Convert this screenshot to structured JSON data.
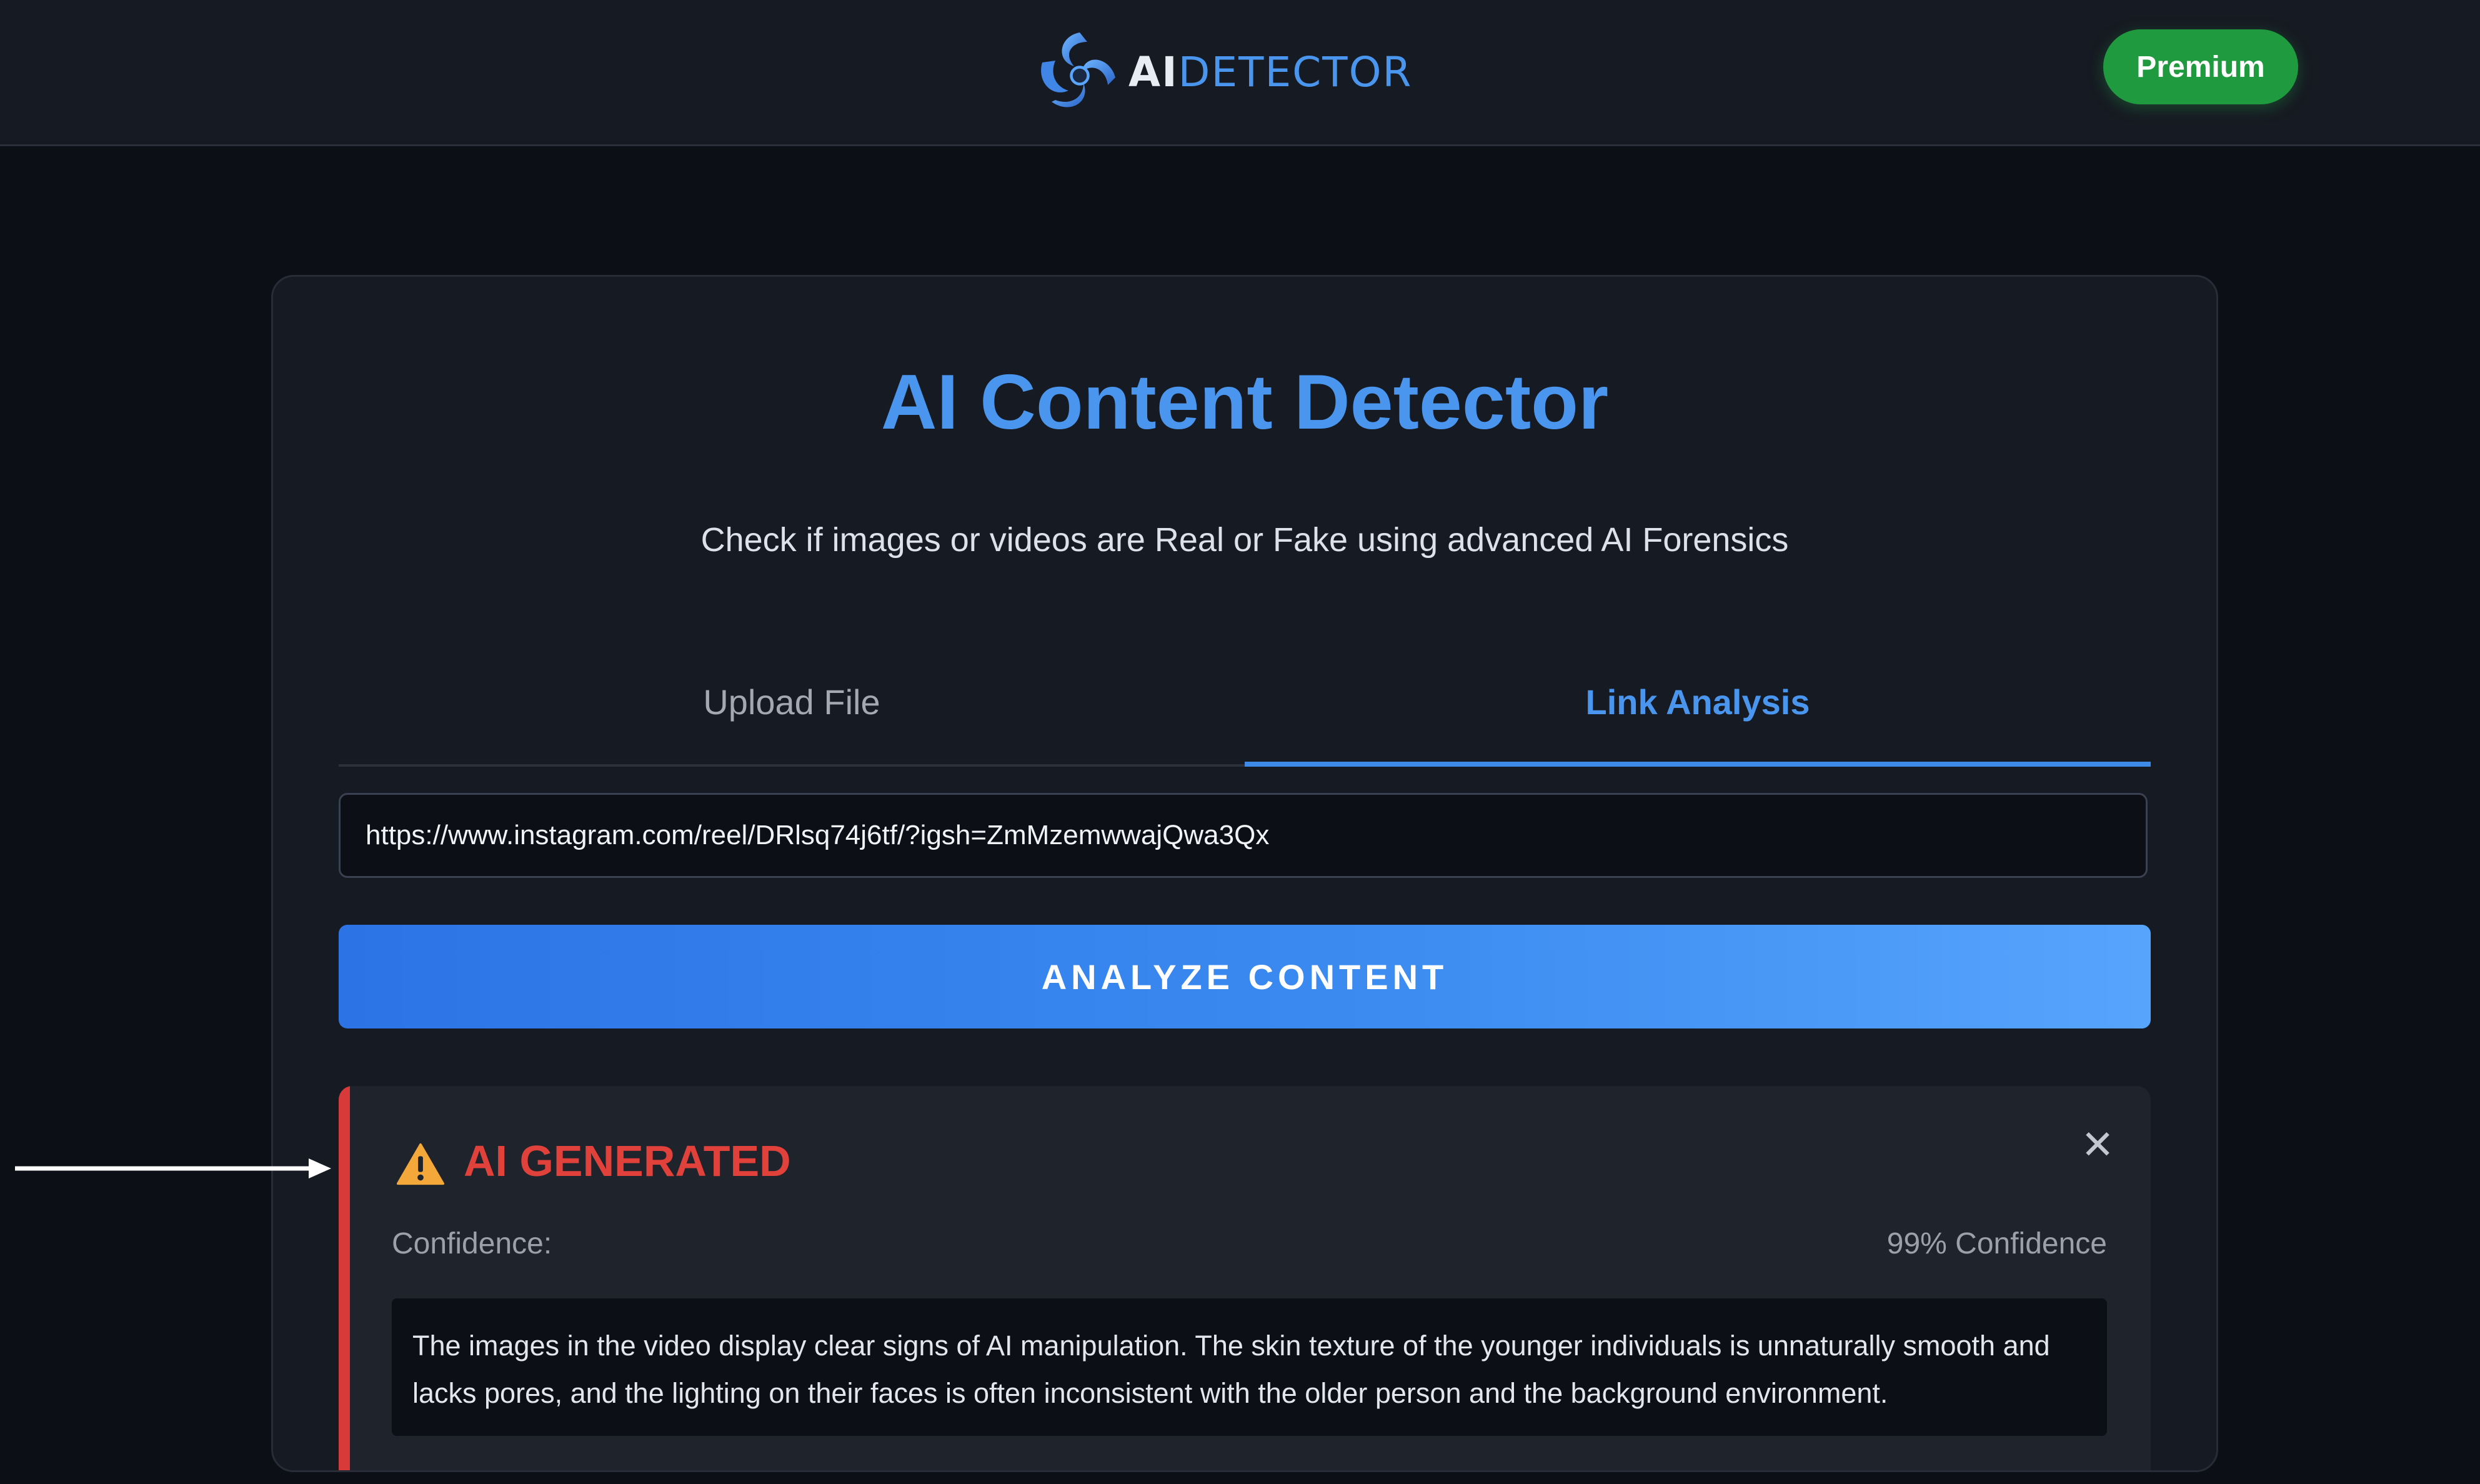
{
  "header": {
    "brand_ai": "AI",
    "brand_detector": "DETECTOR",
    "logo_icon": "spiral-logo-icon",
    "premium_label": "Premium"
  },
  "main": {
    "title": "AI Content Detector",
    "subtitle": "Check if images or videos are Real or Fake using advanced AI Forensics",
    "tabs": [
      {
        "label": "Upload File",
        "active": false
      },
      {
        "label": "Link Analysis",
        "active": true
      }
    ],
    "url_input": {
      "value": "https://www.instagram.com/reel/DRlsq74j6tf/?igsh=ZmMzemwwajQwa3Qx"
    },
    "analyze_label": "ANALYZE CONTENT"
  },
  "result": {
    "icon": "warning-icon",
    "verdict": "AI GENERATED",
    "close_glyph": "✕",
    "confidence_label": "Confidence:",
    "confidence_value": "99% Confidence",
    "explanation": "The images in the video display clear signs of AI manipulation. The skin texture of the younger individuals is unnaturally smooth and lacks pores, and the lighting on their faces is often inconsistent with the older person and the background environment."
  },
  "colors": {
    "page_bg": "#0c0f16",
    "card_bg": "#161a22",
    "accent_blue": "#4a96ee",
    "premium_green": "#1f9a3e",
    "alert_red": "#e0413a",
    "warning_amber": "#f5a83a"
  }
}
